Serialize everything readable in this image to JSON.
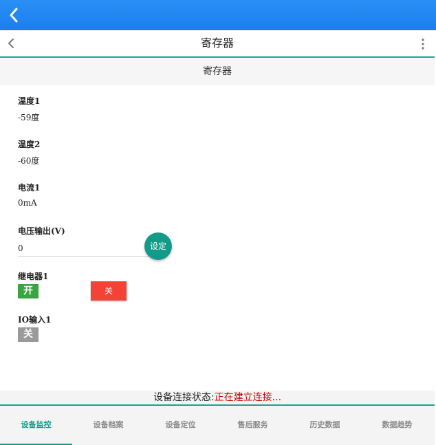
{
  "header": {
    "title": "寄存器",
    "back_icon": "chevron-left-icon",
    "more_icon": "more-vertical-icon"
  },
  "section": {
    "title": "寄存器"
  },
  "registers": [
    {
      "label": "温度1",
      "value": "-59度"
    },
    {
      "label": "温度2",
      "value": "-60度"
    },
    {
      "label": "电流1",
      "value": "0mA"
    }
  ],
  "voltage": {
    "label": "电压输出(V)",
    "value": "0",
    "set_label": "设定"
  },
  "relay": {
    "label": "继电器1",
    "state": "开",
    "off_label": "关"
  },
  "io": {
    "label": "IO输入1",
    "state": "关"
  },
  "status": {
    "prefix": "设备连接状态:",
    "value": "正在建立连接..."
  },
  "tabs": [
    {
      "label": "设备监控",
      "active": true
    },
    {
      "label": "设备档案"
    },
    {
      "label": "设备定位"
    },
    {
      "label": "售后服务"
    },
    {
      "label": "历史数据"
    },
    {
      "label": "数据趋势"
    }
  ],
  "colors": {
    "accent": "#139a88",
    "primary": "#1a7ef0",
    "on": "#3aa443",
    "off": "#f44336",
    "status": "#cc0000"
  }
}
